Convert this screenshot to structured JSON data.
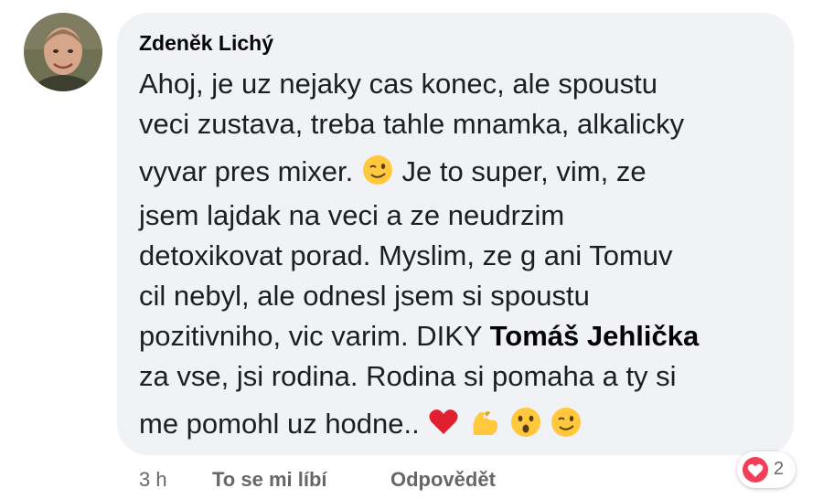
{
  "comment": {
    "author": "Zdeněk Lichý",
    "lines": [
      "Ahoj, je uz nejaky cas konec, ale spoustu",
      "veci zustava, treba tahle mnamka, alkalicky",
      "vyvar pres mixer.",
      "Je to super, vim, ze",
      "jsem lajdak na veci a ze neudrzim",
      "detoxikovat porad. Myslim, ze g ani Tomuv",
      "cil nebyl, ale odnesl jsem si spoustu",
      "pozitivniho, vic varim. DIKY",
      "Tomáš Jehlička",
      "za vse, jsi rodina. Rodina si pomaha a ty si",
      "me pomohl uz hodne.."
    ],
    "emojis": [
      "wink-emoji",
      "heart-emoji",
      "flexed-biceps-emoji",
      "hushed-face-emoji",
      "wink-emoji"
    ],
    "colors": {
      "bubble": "#f0f2f5",
      "reaction": "#f33e58",
      "meta": "#65676b"
    }
  },
  "meta": {
    "time": "3 h",
    "like_label": "To se mi líbí",
    "reply_label": "Odpovědět",
    "reaction_count": "2"
  }
}
